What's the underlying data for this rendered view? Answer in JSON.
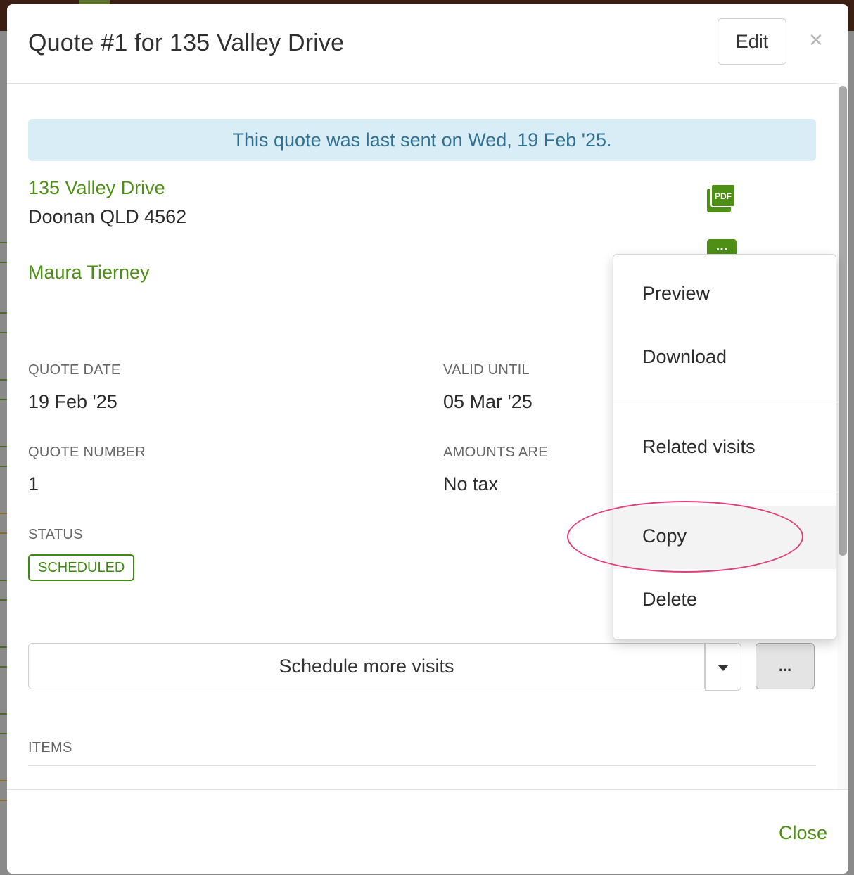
{
  "modal": {
    "title": "Quote #1 for 135 Valley Drive",
    "edit_label": "Edit",
    "close_icon": "×"
  },
  "alert": {
    "text": "This quote was last sent on Wed, 19 Feb '25."
  },
  "address": {
    "line1": "135 Valley Drive",
    "line2": "Doonan QLD 4562"
  },
  "contact_name": "Maura Tierney",
  "icons": {
    "pdf": {
      "name": "pdf-icon",
      "label": "PDF"
    },
    "more": {
      "name": "more-icon",
      "label": "..."
    }
  },
  "details": {
    "quote_date_label": "QUOTE DATE",
    "quote_date": "19 Feb '25",
    "valid_until_label": "VALID UNTIL",
    "valid_until": "05 Mar '25",
    "quote_number_label": "QUOTE NUMBER",
    "quote_number": "1",
    "amounts_are_label": "AMOUNTS ARE",
    "amounts_are": "No tax",
    "status_label": "STATUS",
    "status": "SCHEDULED"
  },
  "actions": {
    "schedule_label": "Schedule more visits",
    "more_label": "..."
  },
  "items": {
    "label": "ITEMS"
  },
  "footer": {
    "close_label": "Close"
  },
  "menu": {
    "items": [
      "Preview",
      "Download",
      "Related visits",
      "Copy",
      "Delete"
    ],
    "hovered": "Copy"
  },
  "colors": {
    "accent_green": "#4e8f16",
    "alert_bg": "#d9edf7",
    "alert_text": "#31708f",
    "highlight": "#e0407a"
  }
}
